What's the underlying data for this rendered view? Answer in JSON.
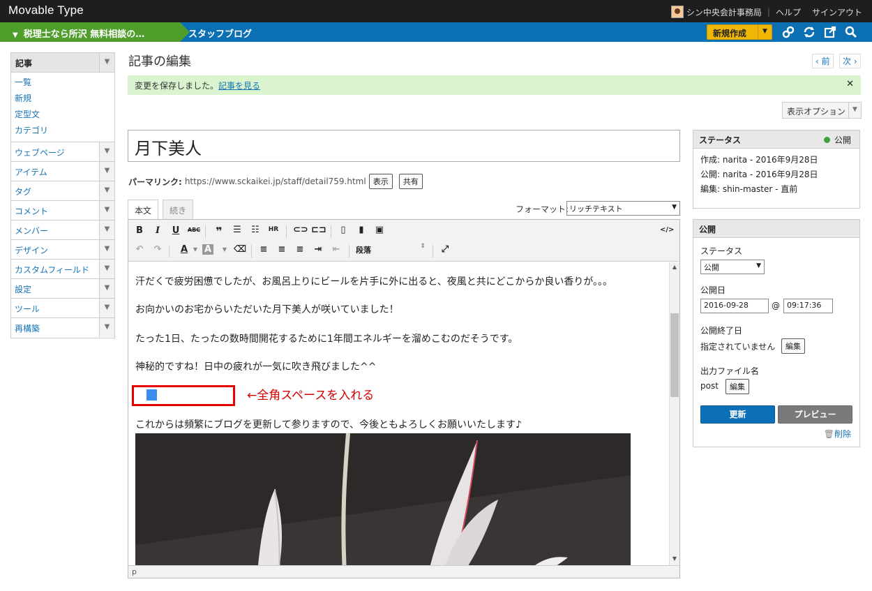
{
  "topbar": {
    "brand": "Movable Type",
    "user": "シン中央会計事務局",
    "help": "ヘルプ",
    "signout": "サインアウト"
  },
  "nav": {
    "site": "税理士なら所沢 無料相談の…",
    "blog": "スタッフブログ",
    "new_label": "新規作成"
  },
  "sidebar": {
    "header": "記事",
    "sub_items": [
      "一覧",
      "新規",
      "定型文",
      "カテゴリ"
    ],
    "items": [
      "ウェブページ",
      "アイテム",
      "タグ",
      "コメント",
      "メンバー",
      "デザイン",
      "カスタムフィールド",
      "設定",
      "ツール",
      "再構築"
    ]
  },
  "main": {
    "title": "記事の編集",
    "prev": "‹ 前",
    "next": "次 ›",
    "saved_msg": "変更を保存しました。",
    "saved_link": "記事を見る",
    "display_options": "表示オプション",
    "entry_title": "月下美人",
    "permalink_label": "パーマリンク:",
    "permalink_url": "https://www.sckaikei.jp/staff/detail759.html",
    "view_btn": "表示",
    "share_btn": "共有",
    "tab_body": "本文",
    "tab_more": "続き",
    "format_label": "フォーマット:",
    "format_value": "リッチテキスト",
    "paragraph_select": "段落",
    "status_path": "p"
  },
  "content": {
    "p1": "汗だくで疲労困憊でしたが、お風呂上りにビールを片手に外に出ると、夜風と共にどこからか良い香りが。。。",
    "p2": "お向かいのお宅からいただいた月下美人が咲いていました！",
    "p3": "たった1日、たったの数時間開花するために1年間エネルギーを溜めこむのだそうです。",
    "p4": "神秘的ですね！日中の疲れが一気に吹き飛びました^^",
    "annotation": "←全角スペースを入れる",
    "p5": "これからは頻繁にブログを更新して参りますので、今後ともよろしくお願いいたします♪"
  },
  "status_panel": {
    "title": "ステータス",
    "state": "公開",
    "created": "作成: narita - 2016年9月28日",
    "published": "公開: narita - 2016年9月28日",
    "edited": "編集: shin-master - 直前"
  },
  "publish_panel": {
    "title": "公開",
    "status_label": "ステータス",
    "status_value": "公開",
    "date_label": "公開日",
    "date_value": "2016-09-28",
    "at": "@",
    "time_value": "09:17:36",
    "end_label": "公開終了日",
    "end_value": "指定されていません",
    "edit_btn": "編集",
    "file_label": "出力ファイル名",
    "file_value": "post",
    "update_btn": "更新",
    "preview_btn": "プレビュー",
    "delete": "削除"
  }
}
